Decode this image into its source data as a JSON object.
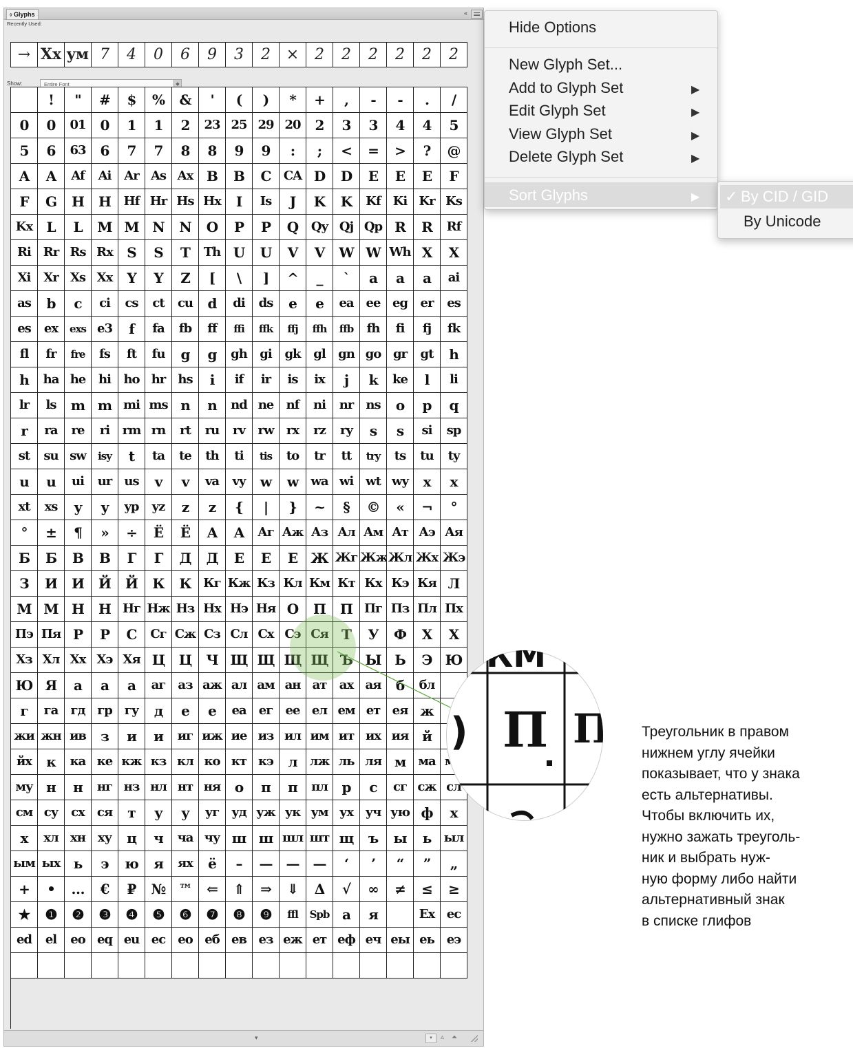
{
  "panel": {
    "title": "Glyphs",
    "collapse_label": "«",
    "recently_used_label": "Recently Used:",
    "recent_glyphs": [
      "→",
      "Xx",
      "yм",
      "7",
      "4",
      "0",
      "6",
      "9",
      "3",
      "2",
      "×",
      "2",
      "2",
      "2",
      "2",
      "2",
      "2"
    ],
    "show_label": "Show:",
    "show_value": "Entire Font",
    "status_arrow": "▾",
    "zoom_select": "▾",
    "zoom_out": "▵",
    "zoom_in": "⏶",
    "rows": [
      [
        "",
        "!",
        "\"",
        "#",
        "$",
        "%",
        "&",
        "'",
        "(",
        ")",
        "*",
        "+",
        ",",
        "-",
        "-",
        ".",
        "/"
      ],
      [
        "0",
        "0",
        "01",
        "0",
        "1",
        "1",
        "2",
        "23",
        "25",
        "29",
        "20",
        "2",
        "3",
        "3",
        "4",
        "4",
        "5"
      ],
      [
        "5",
        "6",
        "63",
        "6",
        "7",
        "7",
        "8",
        "8",
        "9",
        "9",
        ":",
        ";",
        "<",
        "=",
        ">",
        "?",
        "@"
      ],
      [
        "A",
        "A",
        "Af",
        "Ai",
        "Ar",
        "As",
        "Ax",
        "B",
        "B",
        "C",
        "CA",
        "D",
        "D",
        "E",
        "E",
        "E",
        "F"
      ],
      [
        "F",
        "G",
        "H",
        "H",
        "Hf",
        "Hr",
        "Hs",
        "Hx",
        "I",
        "Is",
        "J",
        "K",
        "K",
        "Kf",
        "Ki",
        "Kr",
        "Ks"
      ],
      [
        "Kx",
        "L",
        "L",
        "M",
        "M",
        "N",
        "N",
        "O",
        "P",
        "P",
        "Q",
        "Qy",
        "Qj",
        "Qp",
        "R",
        "R",
        "Rf"
      ],
      [
        "Ri",
        "Rr",
        "Rs",
        "Rx",
        "S",
        "S",
        "T",
        "Th",
        "U",
        "U",
        "V",
        "V",
        "W",
        "W",
        "Wh",
        "X",
        "X"
      ],
      [
        "Xi",
        "Xr",
        "Xs",
        "Xx",
        "Y",
        "Y",
        "Z",
        "[",
        "\\",
        "]",
        "^",
        "_",
        "`",
        "a",
        "a",
        "a",
        "ai"
      ],
      [
        "as",
        "b",
        "c",
        "ci",
        "cs",
        "ct",
        "cu",
        "d",
        "di",
        "ds",
        "e",
        "e",
        "ea",
        "ee",
        "eg",
        "er",
        "es"
      ],
      [
        "es",
        "ex",
        "exs",
        "e3",
        "f",
        "fa",
        "fb",
        "ff",
        "ffi",
        "ffk",
        "ffj",
        "ffh",
        "ffb",
        "fh",
        "fi",
        "fj",
        "fk"
      ],
      [
        "fl",
        "fr",
        "fre",
        "fs",
        "ft",
        "fu",
        "g",
        "g",
        "gh",
        "gi",
        "gk",
        "gl",
        "gn",
        "go",
        "gr",
        "gt",
        "h"
      ],
      [
        "h",
        "ha",
        "he",
        "hi",
        "ho",
        "hr",
        "hs",
        "i",
        "if",
        "ir",
        "is",
        "ix",
        "j",
        "k",
        "ke",
        "l",
        "li"
      ],
      [
        "lr",
        "ls",
        "m",
        "m",
        "mi",
        "ms",
        "n",
        "n",
        "nd",
        "ne",
        "nf",
        "ni",
        "nr",
        "ns",
        "o",
        "p",
        "q"
      ],
      [
        "r",
        "ra",
        "re",
        "ri",
        "rm",
        "rn",
        "rt",
        "ru",
        "rv",
        "rw",
        "rx",
        "rz",
        "ry",
        "s",
        "s",
        "si",
        "sp"
      ],
      [
        "st",
        "su",
        "sw",
        "isy",
        "t",
        "ta",
        "te",
        "th",
        "ti",
        "tis",
        "to",
        "tr",
        "tt",
        "try",
        "ts",
        "tu",
        "ty"
      ],
      [
        "u",
        "u",
        "ui",
        "ur",
        "us",
        "v",
        "v",
        "va",
        "vy",
        "w",
        "w",
        "wa",
        "wi",
        "wt",
        "wy",
        "x",
        "x"
      ],
      [
        "xt",
        "xs",
        "y",
        "y",
        "yp",
        "yz",
        "z",
        "z",
        "{",
        "|",
        "}",
        "~",
        "§",
        "©",
        "«",
        "¬",
        "°"
      ],
      [
        "°",
        "±",
        "¶",
        "»",
        "÷",
        "Ë",
        "Ë",
        "А",
        "А",
        "Аг",
        "Аж",
        "Аз",
        "Ал",
        "Ам",
        "Ат",
        "Аэ",
        "Ая"
      ],
      [
        "Б",
        "Б",
        "В",
        "В",
        "Г",
        "Г",
        "Д",
        "Д",
        "Е",
        "Е",
        "Е",
        "Ж",
        "Жг",
        "Жж",
        "Жл",
        "Жх",
        "Жэ"
      ],
      [
        "З",
        "И",
        "И",
        "Й",
        "Й",
        "К",
        "К",
        "Кг",
        "Кж",
        "Кз",
        "Кл",
        "Км",
        "Кт",
        "Кх",
        "Кэ",
        "Кя",
        "Л"
      ],
      [
        "М",
        "М",
        "Н",
        "Н",
        "Нг",
        "Нж",
        "Нз",
        "Нх",
        "Нэ",
        "Ня",
        "О",
        "П",
        "П",
        "Пг",
        "Пз",
        "Пл",
        "Пх"
      ],
      [
        "Пэ",
        "Пя",
        "Р",
        "Р",
        "С",
        "Сг",
        "Сж",
        "Сз",
        "Сл",
        "Сх",
        "Сэ",
        "Ся",
        "Т",
        "У",
        "Ф",
        "Х",
        "Х"
      ],
      [
        "Хз",
        "Хл",
        "Хх",
        "Хэ",
        "Хя",
        "Ц",
        "Ц",
        "Ч",
        "Щ",
        "Щ",
        "Щ",
        "Щ",
        "Ъ",
        "Ы",
        "Ь",
        "Э",
        "Ю"
      ],
      [
        "Ю",
        "Я",
        "а",
        "а",
        "а",
        "аг",
        "аз",
        "аж",
        "ал",
        "ам",
        "ан",
        "ат",
        "ах",
        "ая",
        "б",
        "бл",
        ""
      ],
      [
        "г",
        "га",
        "гд",
        "гр",
        "гу",
        "д",
        "е",
        "е",
        "еа",
        "ег",
        "ее",
        "ел",
        "ем",
        "ет",
        "ея",
        "ж",
        ""
      ],
      [
        "жи",
        "жн",
        "ив",
        "з",
        "и",
        "и",
        "иг",
        "иж",
        "ие",
        "из",
        "ил",
        "им",
        "ит",
        "их",
        "ия",
        "й",
        ""
      ],
      [
        "йх",
        "к",
        "ка",
        "ке",
        "кж",
        "кз",
        "кл",
        "ко",
        "кт",
        "кэ",
        "л",
        "лж",
        "ль",
        "ля",
        "м",
        "ма",
        "мл"
      ],
      [
        "му",
        "н",
        "н",
        "нг",
        "нз",
        "нл",
        "нт",
        "ня",
        "о",
        "п",
        "п",
        "пл",
        "р",
        "с",
        "сг",
        "сж",
        "сл"
      ],
      [
        "см",
        "су",
        "сх",
        "ся",
        "т",
        "у",
        "у",
        "уг",
        "уд",
        "уж",
        "ук",
        "ум",
        "ух",
        "уч",
        "ую",
        "ф",
        "х"
      ],
      [
        "х",
        "хл",
        "хн",
        "ху",
        "ц",
        "ч",
        "ча",
        "чу",
        "ш",
        "ш",
        "шл",
        "шт",
        "щ",
        "ъ",
        "ы",
        "ь",
        "ыл"
      ],
      [
        "ым",
        "ых",
        "ь",
        "э",
        "ю",
        "я",
        "ях",
        "ё",
        "–",
        "—",
        "—",
        "—",
        "‘",
        "’",
        "“",
        "”",
        "„"
      ],
      [
        "+",
        "•",
        "…",
        "€",
        "₽",
        "№",
        "™",
        "⇐",
        "⇑",
        "⇒",
        "⇓",
        "Δ",
        "√",
        "∞",
        "≠",
        "≤",
        "≥"
      ],
      [
        "★",
        "❶",
        "❷",
        "❸",
        "❹",
        "❺",
        "❻",
        "❼",
        "❽",
        "❾",
        "ffl",
        "Spb",
        "a",
        "я",
        "",
        "Ex",
        "ec"
      ],
      [
        "ed",
        "el",
        "eo",
        "eq",
        "eu",
        "ec",
        "eo",
        "еб",
        "ев",
        "ез",
        "еж",
        "ет",
        "еф",
        "еч",
        "еы",
        "еь",
        "еэ"
      ],
      [
        "",
        "",
        "",
        "",
        "",
        "",
        "",
        "",
        "",
        "",
        "",
        "",
        "",
        "",
        "",
        "",
        ""
      ]
    ]
  },
  "menu": {
    "items": [
      {
        "label": "Hide Options",
        "submenu": false
      },
      {
        "label": "New Glyph Set...",
        "submenu": false
      },
      {
        "label": "Add to Glyph Set",
        "submenu": true
      },
      {
        "label": "Edit Glyph Set",
        "submenu": true
      },
      {
        "label": "View Glyph Set",
        "submenu": true
      },
      {
        "label": "Delete Glyph Set",
        "submenu": true
      },
      {
        "label": "Sort Glyphs",
        "submenu": true
      }
    ],
    "submenu_arrow": "▶"
  },
  "submenu": {
    "items": [
      {
        "label": "By CID / GID",
        "checked": true
      },
      {
        "label": "By Unicode",
        "checked": false
      }
    ],
    "check_mark": "✓"
  },
  "callout": {
    "zoom_glyph_left": ")",
    "zoom_glyph_main": "П",
    "zoom_glyph_right": "П",
    "zoom_glyph_top": "КМ",
    "caption": "Треугольник в правом\nнижнем углу ячейки\nпоказывает, что у знака\nесть альтернативы.\nЧтобы включить их,\nнужно зажать треуголь-\nник и выбрать нуж-\nную форму либо найти\nальтернативный знак\nв списке глифов"
  },
  "colors": {
    "menu_bg": "#f3f3f3",
    "highlight": "#dcdcdc",
    "disabled_text": "#ffffff",
    "callout_green": "#82be5a"
  }
}
